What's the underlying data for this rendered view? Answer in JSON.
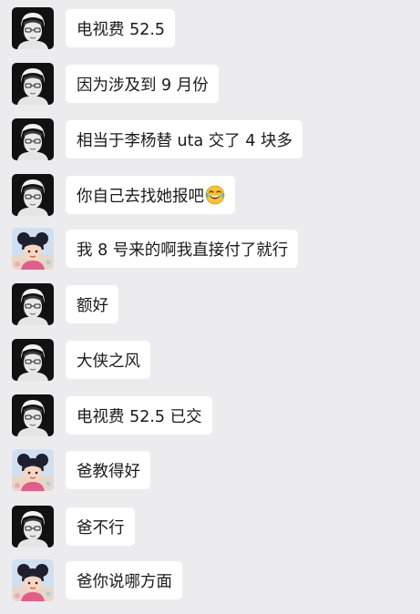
{
  "messages": [
    {
      "sender": "dark-avatar",
      "text": "电视费 52.5"
    },
    {
      "sender": "dark-avatar",
      "text": "因为涉及到 9 月份"
    },
    {
      "sender": "dark-avatar",
      "text": "相当于李杨替 uta 交了 4 块多"
    },
    {
      "sender": "dark-avatar",
      "text": "你自己去找她报吧",
      "emoji": "laughing-tears-emoji"
    },
    {
      "sender": "child-avatar",
      "text": "我 8 号来的啊我直接付了就行"
    },
    {
      "sender": "dark-avatar",
      "text": "额好"
    },
    {
      "sender": "dark-avatar",
      "text": "大侠之风"
    },
    {
      "sender": "dark-avatar",
      "text": "电视费 52.5 已交"
    },
    {
      "sender": "child-avatar",
      "text": "爸教得好"
    },
    {
      "sender": "dark-avatar",
      "text": "爸不行"
    },
    {
      "sender": "child-avatar",
      "text": "爸你说哪方面"
    }
  ]
}
